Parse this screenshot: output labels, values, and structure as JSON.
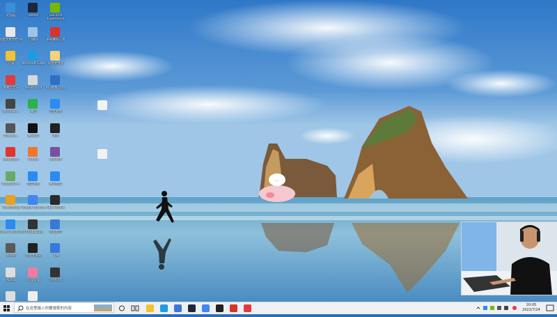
{
  "desktop_icons": [
    {
      "label": "此电脑",
      "color": "#3b8fd8"
    },
    {
      "label": "Steam",
      "color": "#1b2838"
    },
    {
      "label": "GeForce Experience",
      "color": "#76b900"
    },
    {
      "label": "新建文本文档.txt",
      "color": "#e8e8e8"
    },
    {
      "label": "回收站",
      "color": "#9cc4e8"
    },
    {
      "label": "系统维护工具",
      "color": "#d9322b"
    },
    {
      "label": "迅雷",
      "color": "#f2c230"
    },
    {
      "label": "Microsoft Edge",
      "color": "#1f9be0"
    },
    {
      "label": "新建文件夹",
      "color": "#f4d27a"
    },
    {
      "label": "网易云音乐",
      "color": "#e03c3c"
    },
    {
      "label": "desktop.ini",
      "color": "#d8d8d8"
    },
    {
      "label": "PPT模板.pptx",
      "color": "#2f6fc6"
    },
    {
      "label": "Windows...",
      "color": "#444"
    },
    {
      "label": "微信",
      "color": "#2bb24c"
    },
    {
      "label": "百度网盘",
      "color": "#2a8cf0"
    },
    {
      "label": "VMware...",
      "color": "#555"
    },
    {
      "label": "腾讯QQ",
      "color": "#111"
    },
    {
      "label": "游戏",
      "color": "#222"
    },
    {
      "label": "Bandicam",
      "color": "#e0342c"
    },
    {
      "label": "Firefox",
      "color": "#f0762c"
    },
    {
      "label": "WinRAR",
      "color": "#7a4fa0"
    },
    {
      "label": "Notepad++",
      "color": "#6a6"
    },
    {
      "label": "百度网盘",
      "color": "#2a8cf0"
    },
    {
      "label": "腾讯会议",
      "color": "#2a8cf0"
    },
    {
      "label": "Everything",
      "color": "#e8a020"
    },
    {
      "label": "Google Chrome",
      "color": "#4285f4"
    },
    {
      "label": "OBS Studio",
      "color": "#2a2a2a"
    },
    {
      "label": "Screen Recorder",
      "color": "#2a8cf0"
    },
    {
      "label": "OBS录屏.jpg",
      "color": "#333"
    },
    {
      "label": "迅雷影音",
      "color": "#3a78d8"
    },
    {
      "label": "Xshell",
      "color": "#5a5a5a"
    },
    {
      "label": "新建文件夹",
      "color": "#222"
    },
    {
      "label": "飞书",
      "color": "#3a78d8"
    },
    {
      "label": "Apifox",
      "color": "#ddd"
    },
    {
      "label": "哔哩哔哩",
      "color": "#f07ca0"
    },
    {
      "label": "Terminal",
      "color": "#333"
    },
    {
      "label": "ZIP.zip",
      "color": "#ddd"
    },
    {
      "label": "新建文本.txt",
      "color": "#eee"
    }
  ],
  "taskbar": {
    "search_placeholder": "在这里输入你要搜索的内容",
    "time": "20:05",
    "date": "2022/7/24",
    "pinned_apps": [
      {
        "name": "file-explorer",
        "color": "#f2c230"
      },
      {
        "name": "edge",
        "color": "#1f9be0"
      },
      {
        "name": "explorer",
        "color": "#3a78d8"
      },
      {
        "name": "steam",
        "color": "#1b2838"
      },
      {
        "name": "chrome",
        "color": "#4285f4"
      },
      {
        "name": "obs",
        "color": "#222"
      },
      {
        "name": "counter-strike",
        "color": "#d9322b"
      },
      {
        "name": "netease-music",
        "color": "#e03c3c"
      }
    ]
  }
}
